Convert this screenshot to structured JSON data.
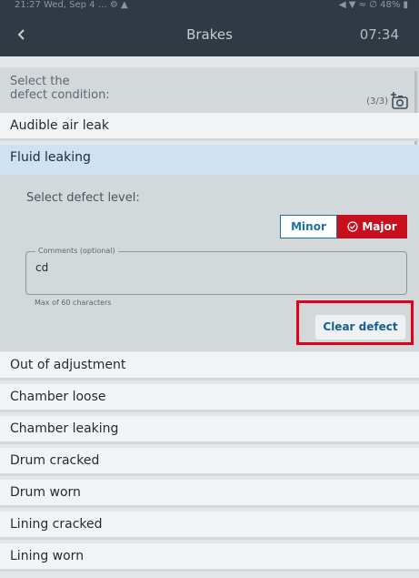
{
  "status_bar": {
    "left": "21:27  Wed, Sep 4  … ⚙ ▲",
    "right": "◀ ▼ ≈ ∅ 48% ▮"
  },
  "app_bar": {
    "back_icon": "chevron-left-icon",
    "title": "Brakes",
    "timer": "07:34"
  },
  "header": {
    "label": "Select the\ndefect condition:",
    "count": "(3/3)",
    "camera_icon": "camera-add-icon"
  },
  "defects": [
    {
      "label": "Audible air leak",
      "selected": false
    },
    {
      "label": "Fluid leaking",
      "selected": true
    },
    {
      "label": "Out of adjustment",
      "selected": false
    },
    {
      "label": "Chamber loose",
      "selected": false
    },
    {
      "label": "Chamber leaking",
      "selected": false
    },
    {
      "label": "Drum cracked",
      "selected": false
    },
    {
      "label": "Drum worn",
      "selected": false
    },
    {
      "label": "Lining cracked",
      "selected": false
    },
    {
      "label": "Lining worn",
      "selected": false
    }
  ],
  "expanded": {
    "level_label": "Select defect level:",
    "minor_label": "Minor",
    "major_label": "Major",
    "selected_level": "Major",
    "comments_legend": "Comments (optional)",
    "comments_value": "cd",
    "helper": "Max of 60 characters",
    "clear_label": "Clear defect"
  },
  "colors": {
    "app_bar": "#2f3a44",
    "accent_blue": "#1a73a8",
    "major_red": "#c80f1e",
    "highlight_red": "#e0001b",
    "selected_row": "#cde3f4"
  }
}
